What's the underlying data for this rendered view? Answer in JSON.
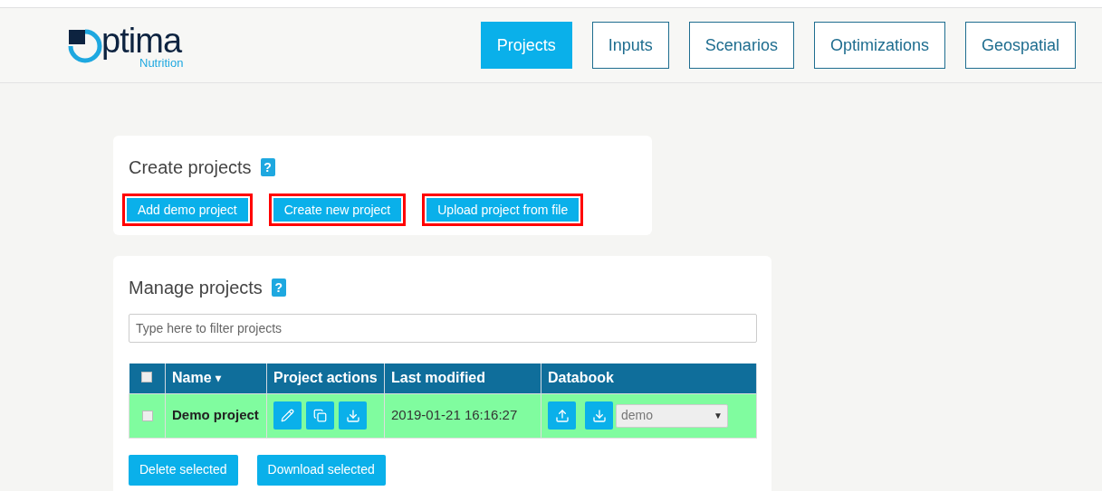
{
  "logo": {
    "title": "ptima",
    "subtitle": "Nutrition"
  },
  "nav": [
    {
      "label": "Projects",
      "selected": true
    },
    {
      "label": "Inputs",
      "selected": false
    },
    {
      "label": "Scenarios",
      "selected": false
    },
    {
      "label": "Optimizations",
      "selected": false
    },
    {
      "label": "Geospatial",
      "selected": false
    }
  ],
  "create_card": {
    "title": "Create projects",
    "help": "?",
    "buttons": [
      {
        "label": "Add demo project",
        "highlighted": true
      },
      {
        "label": "Create new project",
        "highlighted": true
      },
      {
        "label": "Upload project from file",
        "highlighted": true
      }
    ]
  },
  "manage_card": {
    "title": "Manage projects",
    "help": "?",
    "filter": {
      "placeholder": "Type here to filter projects"
    },
    "table": {
      "select_all": {
        "checked": false
      },
      "columns": [
        "Name",
        "Project actions",
        "Last modified",
        "Databook"
      ],
      "sort_caret": "▾",
      "rows": [
        {
          "checked": false,
          "selected": true,
          "name": "Demo project",
          "last_modified": "2019-01-21 16:16:27",
          "databook": "demo",
          "caret": "▼"
        }
      ]
    },
    "buttons": [
      "Delete selected",
      "Download selected"
    ]
  }
}
